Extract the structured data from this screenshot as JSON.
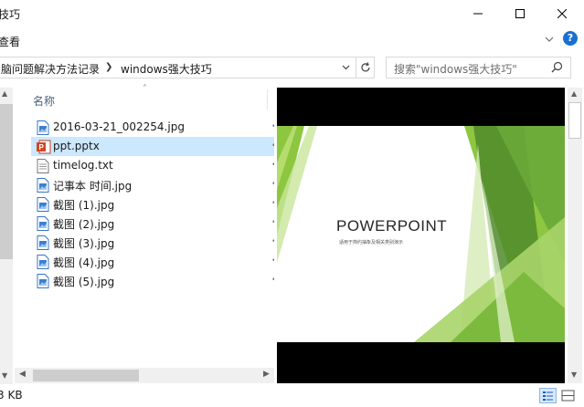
{
  "window": {
    "title": "技巧"
  },
  "menu": {
    "view": "查看"
  },
  "address": {
    "segment1": "脑问题解决方法记录",
    "segment2": "windows强大技巧"
  },
  "search": {
    "placeholder": "搜索\"windows强大技巧\""
  },
  "columns": {
    "name": "名称"
  },
  "files": [
    {
      "name": "2016-03-21_002254.jpg",
      "type": "jpg"
    },
    {
      "name": "ppt.pptx",
      "type": "pptx",
      "selected": true
    },
    {
      "name": "timelog.txt",
      "type": "txt"
    },
    {
      "name": "记事本 时间.jpg",
      "type": "jpg"
    },
    {
      "name": "截图 (1).jpg",
      "type": "jpg"
    },
    {
      "name": "截图 (2).jpg",
      "type": "jpg"
    },
    {
      "name": "截图 (3).jpg",
      "type": "jpg"
    },
    {
      "name": "截图 (4).jpg",
      "type": "jpg"
    },
    {
      "name": "截图 (5).jpg",
      "type": "jpg"
    }
  ],
  "preview": {
    "title": "POWERPOINT",
    "subtitle": "适用于简约抽象及相关类别演示"
  },
  "status": {
    "size": "3 KB"
  },
  "colors": {
    "selection": "#cce8ff",
    "slide_green": "#8dc63f",
    "slide_dark_green": "#4f8a2a"
  }
}
